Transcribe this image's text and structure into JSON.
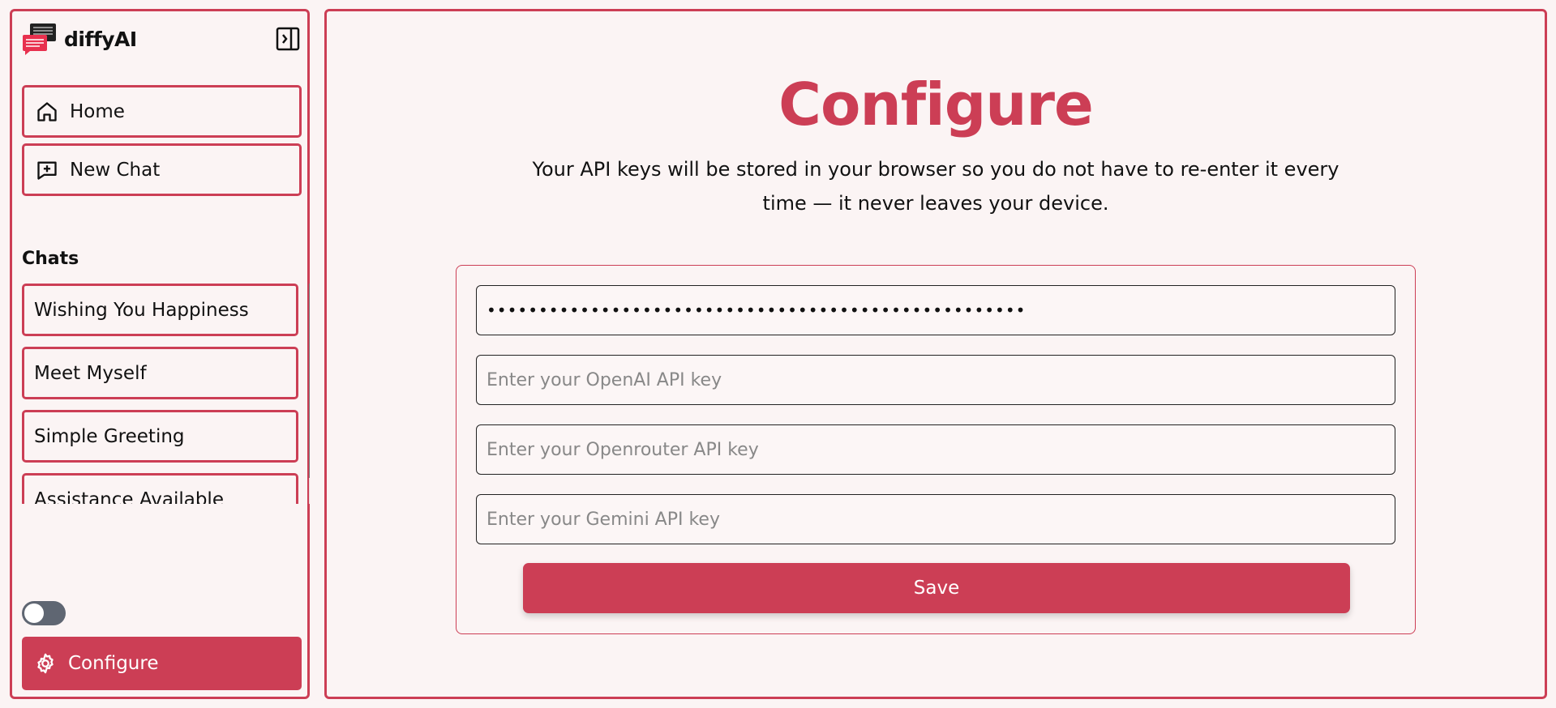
{
  "app": {
    "name": "diffyAI"
  },
  "sidebar": {
    "nav": [
      {
        "label": "Home",
        "icon": "home-icon"
      },
      {
        "label": "New Chat",
        "icon": "message-plus-icon"
      }
    ],
    "chats_heading": "Chats",
    "chats": [
      "Wishing You Happiness",
      "Meet Myself",
      "Simple Greeting",
      "Assistance Available"
    ],
    "theme_toggle": {
      "on": false
    },
    "configure_label": "Configure"
  },
  "main": {
    "title": "Configure",
    "subtitle_line1": "Your API keys will be stored in your browser so you do not have to re-enter it every",
    "subtitle_line2": "time — it never leaves your device.",
    "fields": {
      "key1_value": "••••••••••••••••••••••••••••••••••••••••••••••••••••",
      "openai_placeholder": "Enter your OpenAI API key",
      "openrouter_placeholder": "Enter your Openrouter API key",
      "gemini_placeholder": "Enter your Gemini API key"
    },
    "save_label": "Save"
  },
  "colors": {
    "accent": "#cc3e55",
    "background": "#fbf4f4",
    "toggle_off": "#5f6672"
  }
}
